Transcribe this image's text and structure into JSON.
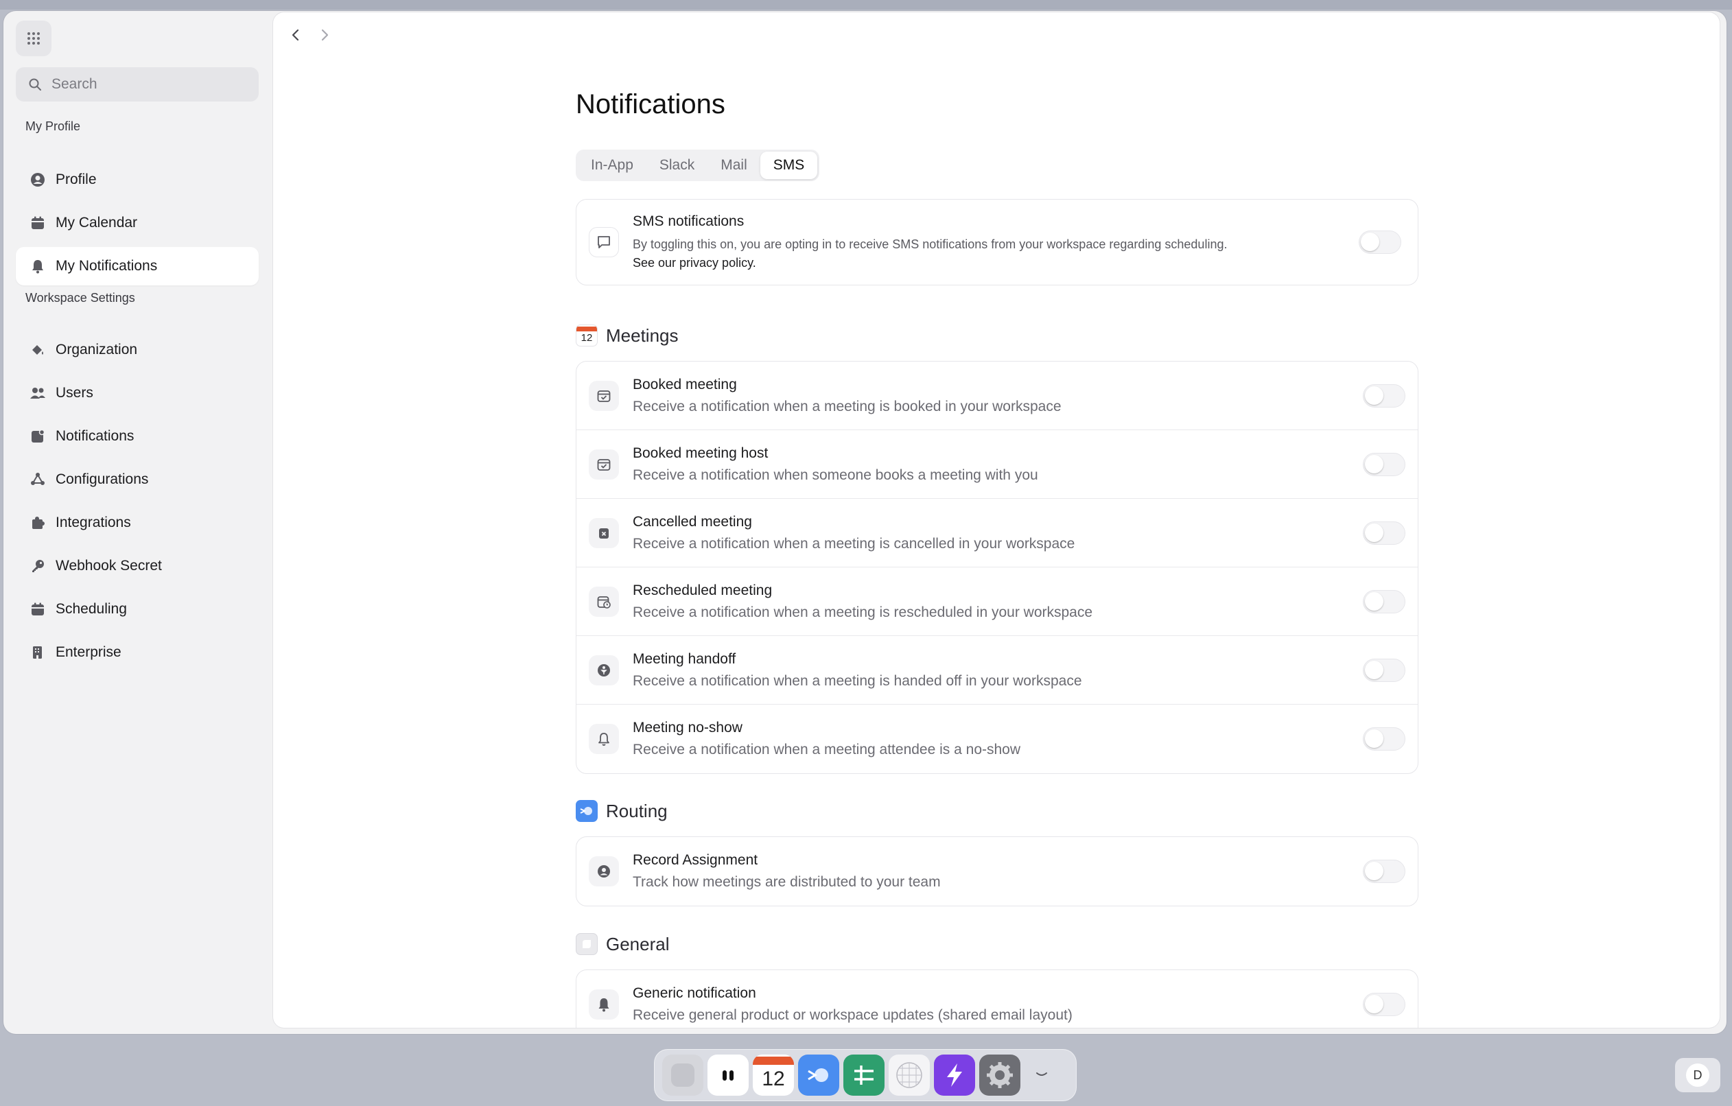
{
  "sidebar": {
    "search_placeholder": "Search",
    "section_profile": "My Profile",
    "profile_items": [
      {
        "label": "Profile",
        "icon": "user-circle-icon"
      },
      {
        "label": "My Calendar",
        "icon": "calendar-icon"
      },
      {
        "label": "My Notifications",
        "icon": "bell-icon",
        "active": true
      }
    ],
    "section_workspace": "Workspace Settings",
    "workspace_items": [
      {
        "label": "Organization",
        "icon": "paint-bucket-icon"
      },
      {
        "label": "Users",
        "icon": "users-icon"
      },
      {
        "label": "Notifications",
        "icon": "notification-badge-icon"
      },
      {
        "label": "Configurations",
        "icon": "nodes-icon"
      },
      {
        "label": "Integrations",
        "icon": "puzzle-icon"
      },
      {
        "label": "Webhook Secret",
        "icon": "key-icon"
      },
      {
        "label": "Scheduling",
        "icon": "calendar-icon"
      },
      {
        "label": "Enterprise",
        "icon": "building-icon"
      }
    ]
  },
  "main": {
    "title": "Notifications",
    "tabs": [
      "In-App",
      "Slack",
      "Mail",
      "SMS"
    ],
    "active_tab": "SMS",
    "sms": {
      "title": "SMS notifications",
      "description": "By toggling this on, you are opting in to receive SMS notifications from your workspace regarding scheduling.",
      "privacy_link": "See our privacy policy.",
      "enabled": false
    },
    "sections": [
      {
        "title": "Meetings",
        "badge": "12",
        "rows": [
          {
            "title": "Booked meeting",
            "desc": "Receive a notification when a meeting is booked in your workspace",
            "icon": "calendar-check-icon",
            "enabled": false
          },
          {
            "title": "Booked meeting host",
            "desc": "Receive a notification when someone books a meeting with you",
            "icon": "calendar-check-icon",
            "enabled": false
          },
          {
            "title": "Cancelled meeting",
            "desc": "Receive a notification when a meeting is cancelled in your workspace",
            "icon": "calendar-x-icon",
            "enabled": false
          },
          {
            "title": "Rescheduled meeting",
            "desc": "Receive a notification when a meeting is rescheduled in your workspace",
            "icon": "calendar-clock-icon",
            "enabled": false
          },
          {
            "title": "Meeting handoff",
            "desc": "Receive a notification when a meeting is handed off in your workspace",
            "icon": "handoff-icon",
            "enabled": false
          },
          {
            "title": "Meeting no-show",
            "desc": "Receive a notification when a meeting attendee is a no-show",
            "icon": "bell-icon",
            "enabled": false
          }
        ]
      },
      {
        "title": "Routing",
        "rows": [
          {
            "title": "Record Assignment",
            "desc": "Track how meetings are distributed to your team",
            "icon": "user-circle-icon",
            "enabled": false
          }
        ]
      },
      {
        "title": "General",
        "rows": [
          {
            "title": "Generic notification",
            "desc": "Receive general product or workspace updates (shared email layout)",
            "icon": "bell-icon",
            "enabled": false
          }
        ]
      }
    ]
  },
  "dock": {
    "calendar_badge": "12",
    "avatar_letter": "D"
  },
  "colors": {
    "accent_orange": "#e4572e",
    "routing_blue": "#4a8df0",
    "purple_app": "#7b3fe4",
    "green_app": "#2e9f6e"
  }
}
